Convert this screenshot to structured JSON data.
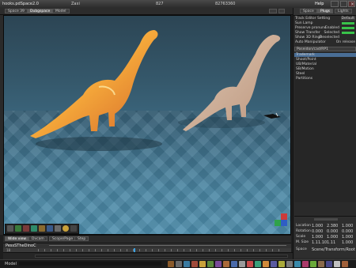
{
  "title_bar": {
    "app_title": "hooks.pdSpace2.0",
    "file_name": "Zaxi",
    "frame_number": "827",
    "object_id": "82763360",
    "right_label": "Help"
  },
  "tabs": [
    {
      "label": "Space 39"
    },
    {
      "label": "Dubgspace"
    },
    {
      "label": "Model"
    }
  ],
  "viewport": {
    "colors": {
      "dino_left": "#f4a73a",
      "dino_right": "#e9c3a1",
      "floor": "#4a86a3"
    }
  },
  "right_panel": {
    "tabs": [
      {
        "label": "Space"
      },
      {
        "label": "Plugs"
      },
      {
        "label": "Lights"
      }
    ],
    "header_rows": [
      {
        "label": "Track Editor Setting",
        "value": "Default"
      },
      {
        "label": "Sun Lamp",
        "value": ""
      },
      {
        "label": "Preserve pronunc",
        "value": "Enabled"
      },
      {
        "label": "Show Transfer",
        "value": "Selected"
      },
      {
        "label": "Show 3D Rings",
        "value": "Deselected"
      },
      {
        "label": "Auto Manipulator",
        "value": "On release"
      }
    ],
    "list_header": "Poseidon/cad/RP1",
    "list_items": [
      "Trademark",
      "Shoot/Point",
      "UB/Material",
      "SB/Motion",
      "Steel",
      "Partitions"
    ],
    "transform": {
      "rows": [
        {
          "label": "Location",
          "x": "1.000",
          "y": "2.380",
          "z": "1.000"
        },
        {
          "label": "Rotation",
          "x": "0.000",
          "y": "0.000",
          "z": "0.000"
        },
        {
          "label": "Scale",
          "x": "1.000",
          "y": "1.000",
          "z": "1.000"
        },
        {
          "label": "M. Size",
          "x": "1.11.10",
          "y": "1.11",
          "z": "1.000"
        }
      ],
      "space_label": "Space",
      "space_value": "Scene/Transform/Root"
    }
  },
  "timeline": {
    "tabs": [
      {
        "label": "Wide view"
      },
      {
        "label": "Dvcam"
      },
      {
        "label": "Scope/Page"
      },
      {
        "label": "Step"
      }
    ],
    "track_name": "PessSTheDinoC",
    "frame_marker": "18"
  },
  "status_bar": {
    "label": "Model"
  }
}
